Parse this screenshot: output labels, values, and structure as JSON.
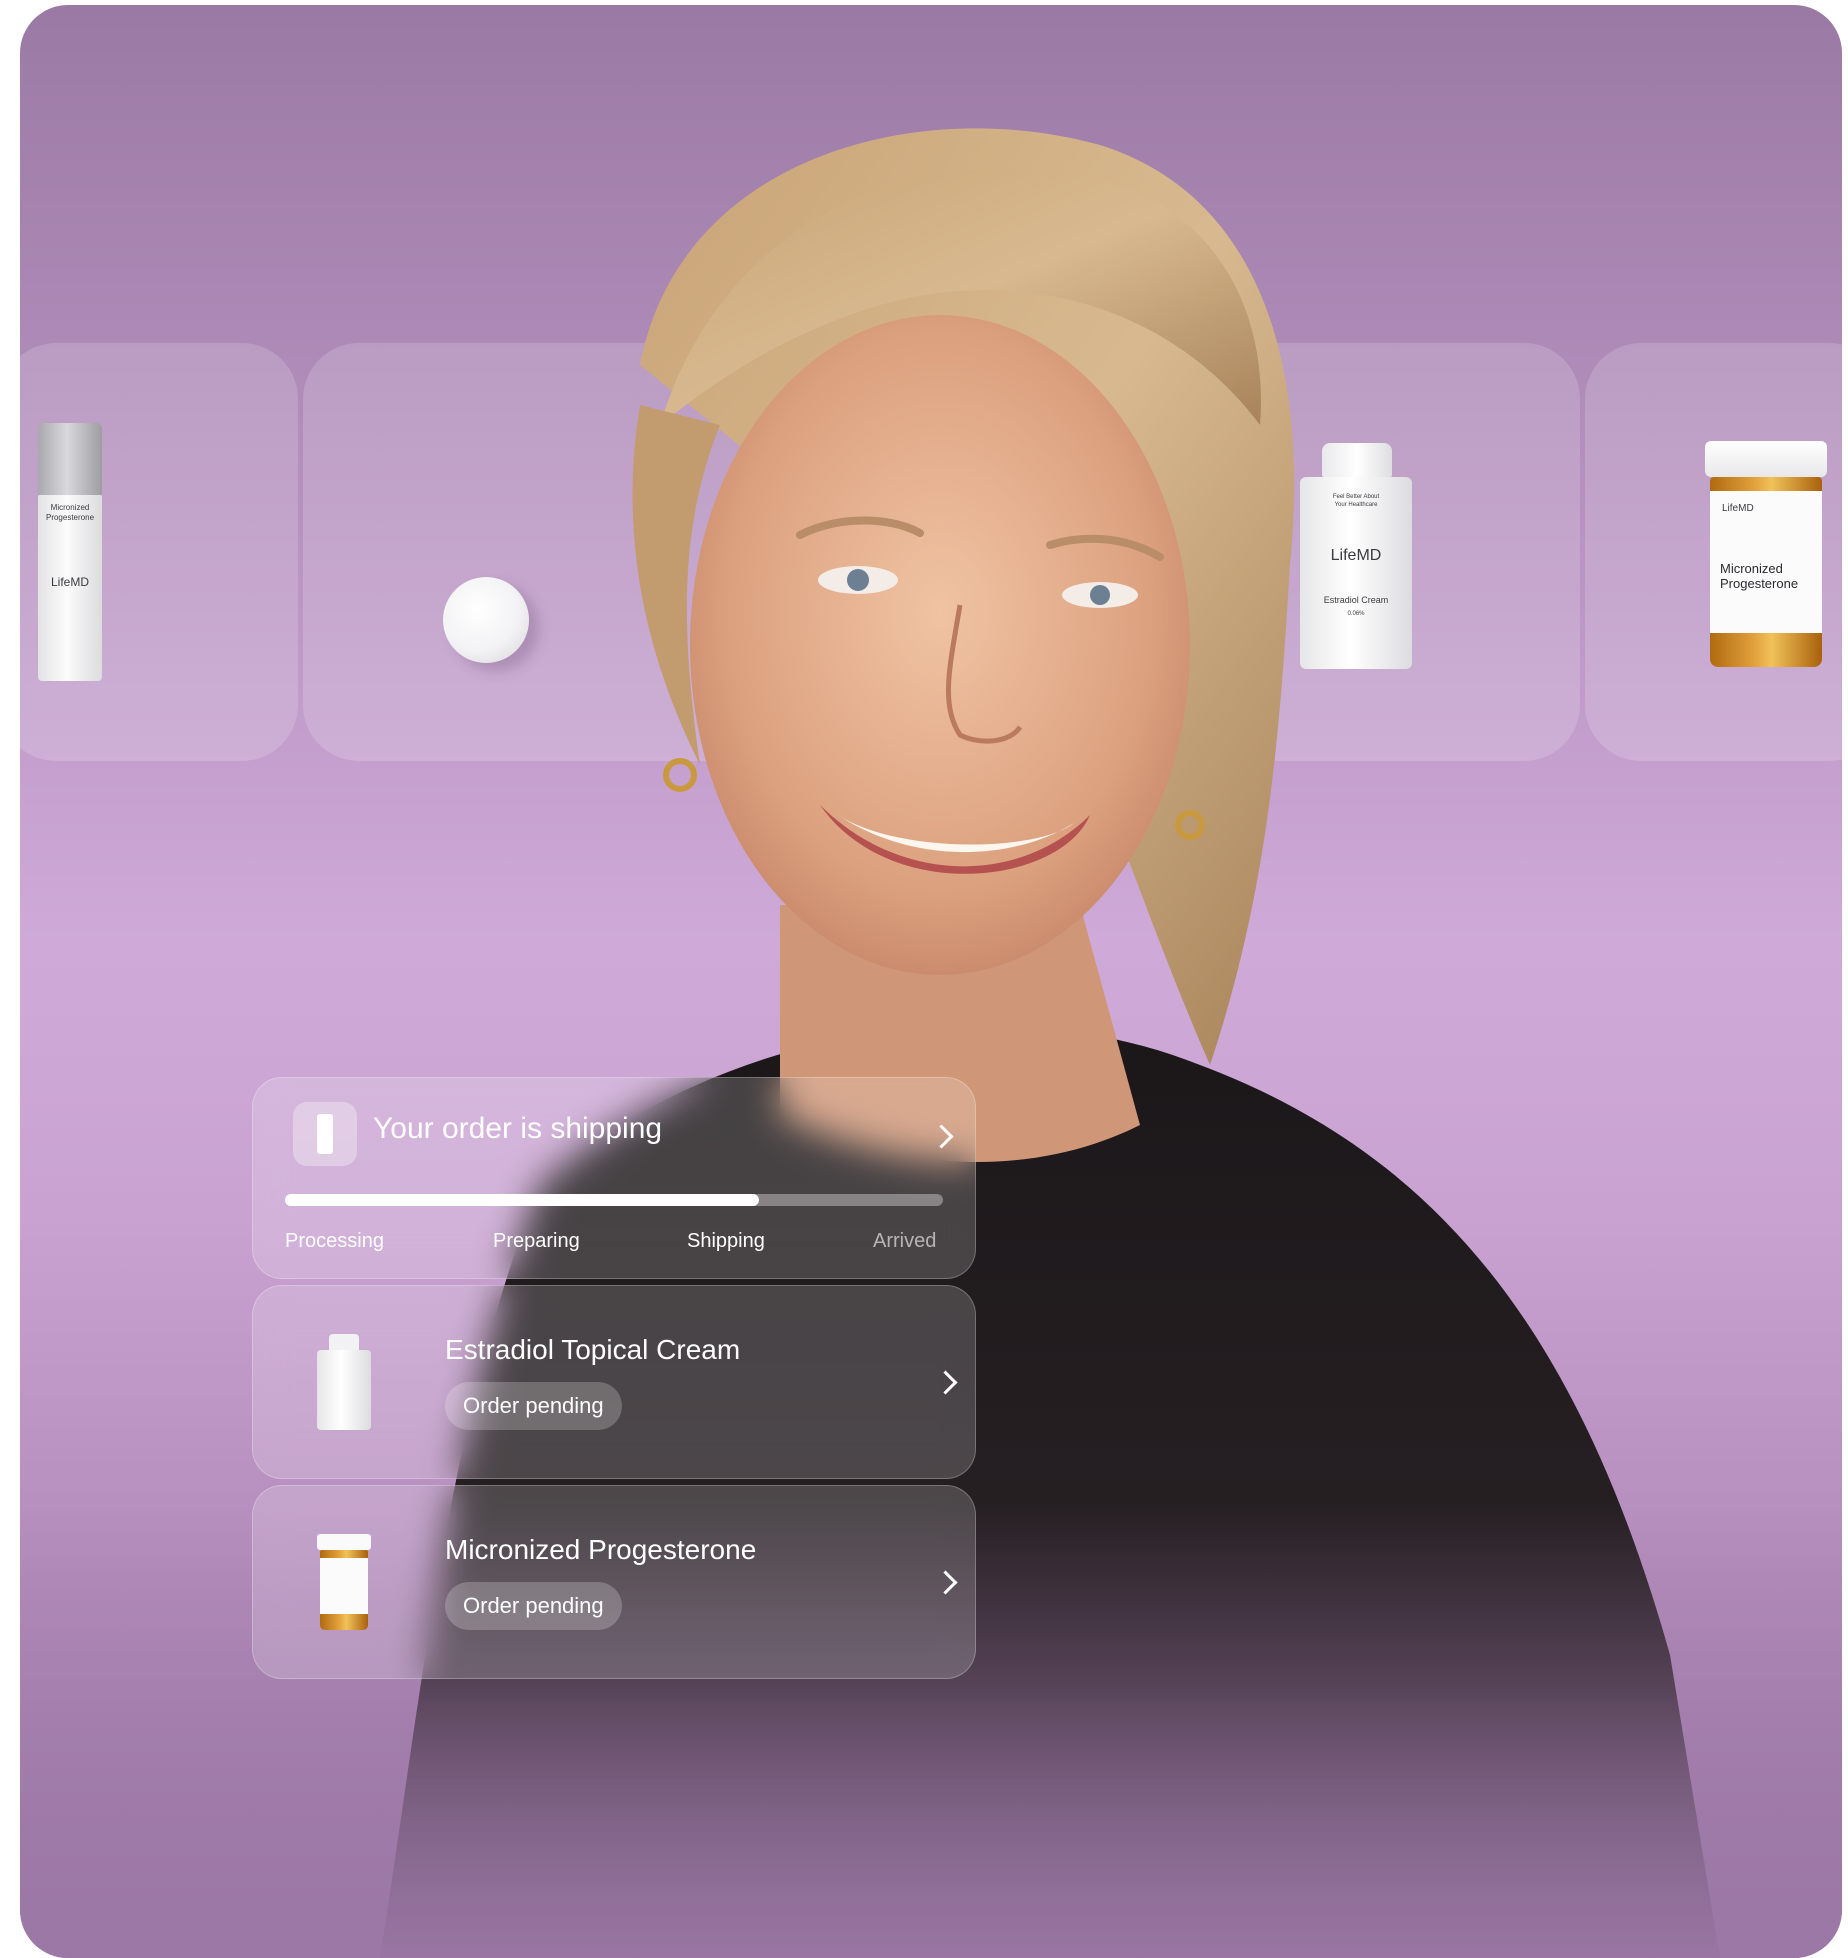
{
  "products": [
    {
      "name": "micronized-progesterone-spray",
      "label_lines": [
        "Micronized",
        "Progesterone"
      ],
      "brand": "LifeMD"
    },
    {
      "name": "pill-tablet"
    },
    {
      "name": "estradiol-cream-pump",
      "tagline": [
        "Feel Better About",
        "Your Healthcare"
      ],
      "brand": "LifeMD",
      "product": "Estradiol Cream",
      "strength": "0.06%"
    },
    {
      "name": "micronized-progesterone-bottle",
      "brand": "LifeMD",
      "label_lines": [
        "Micronized",
        "Progesterone"
      ]
    }
  ],
  "order_status": {
    "title": "Your order is shipping",
    "progress": 0.72,
    "stages": [
      "Processing",
      "Preparing",
      "Shipping",
      "Arrived"
    ],
    "active_stage": "Shipping"
  },
  "orders": [
    {
      "title": "Estradiol Topical Cream",
      "status": "Order pending"
    },
    {
      "title": "Micronized Progesterone",
      "status": "Order pending"
    }
  ],
  "colors": {
    "background": "#b691bf",
    "accent_white": "#ffffff",
    "amber": "#e2a23c"
  }
}
